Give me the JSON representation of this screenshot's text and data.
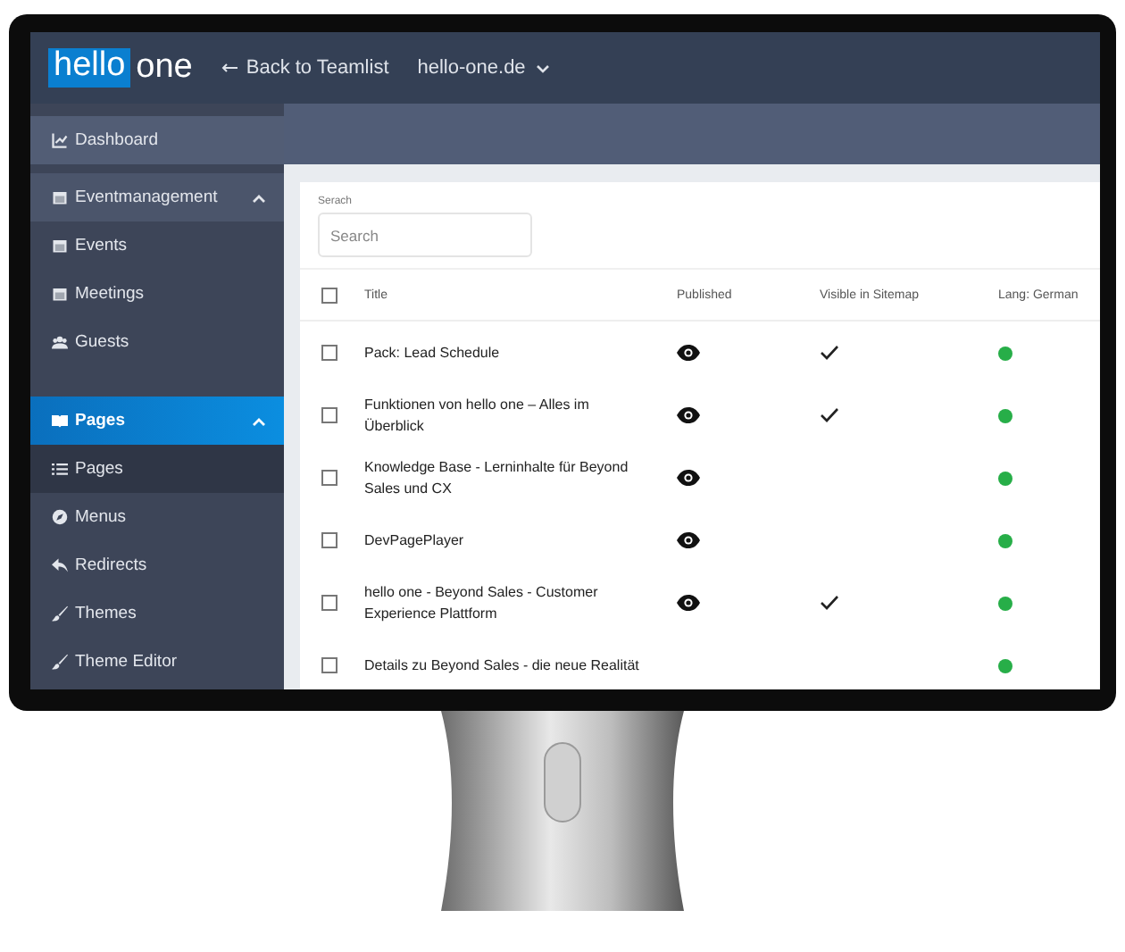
{
  "header": {
    "logo_left": "hello",
    "logo_right": "one",
    "back_link": "Back to Teamlist",
    "site_selector": "hello-one.de"
  },
  "sidebar": {
    "sections": [
      {
        "kind": "link",
        "label": "Dashboard",
        "selected": false
      },
      {
        "kind": "group",
        "label": "Eventmanagement",
        "selected": false,
        "expanded": true,
        "children": [
          {
            "label": "Events",
            "selected": false
          },
          {
            "label": "Meetings",
            "selected": false
          },
          {
            "label": "Guests",
            "selected": false
          }
        ]
      },
      {
        "kind": "group",
        "label": "Pages",
        "selected": true,
        "expanded": true,
        "children": [
          {
            "label": "Pages",
            "selected": true
          },
          {
            "label": "Menus",
            "selected": false
          },
          {
            "label": "Redirects",
            "selected": false
          },
          {
            "label": "Themes",
            "selected": false
          },
          {
            "label": "Theme Editor",
            "selected": false
          }
        ]
      }
    ]
  },
  "search": {
    "label": "Serach",
    "placeholder": "Search"
  },
  "table": {
    "all_checked": false,
    "columns": [
      "Title",
      "Published",
      "Visible in Sitemap",
      "Lang: German"
    ],
    "rows": [
      {
        "checked": false,
        "title": "Pack: Lead Schedule",
        "published": true,
        "sitemap": true,
        "german": true
      },
      {
        "checked": false,
        "title": "Funktionen von hello one – Alles im Überblick",
        "published": true,
        "sitemap": true,
        "german": true
      },
      {
        "checked": false,
        "title": "Knowledge Base - Lerninhalte für Beyond Sales und CX",
        "published": true,
        "sitemap": false,
        "german": true
      },
      {
        "checked": false,
        "title": "DevPagePlayer",
        "published": true,
        "sitemap": false,
        "german": true
      },
      {
        "checked": false,
        "title": "hello one - Beyond Sales - Customer Experience Plattform",
        "published": true,
        "sitemap": true,
        "german": true
      },
      {
        "checked": false,
        "title": "Details zu Beyond Sales - die neue Realität",
        "published": false,
        "sitemap": false,
        "german": true
      }
    ]
  }
}
